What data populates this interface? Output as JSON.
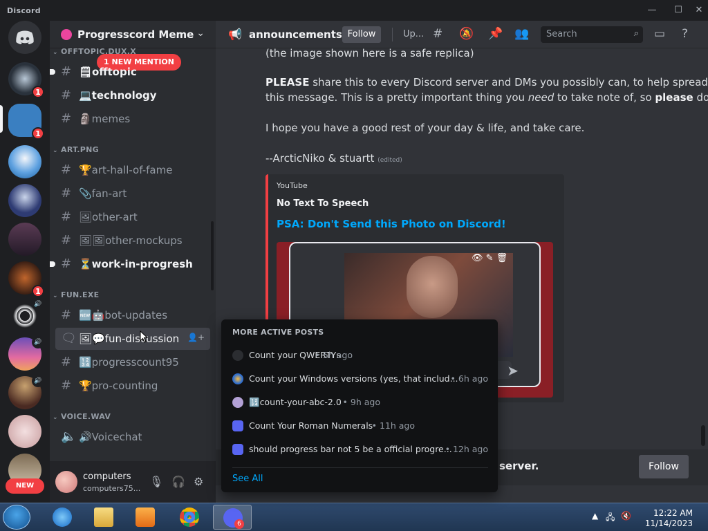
{
  "window": {
    "title": "Discord"
  },
  "server": {
    "name": "Progresscord Meme"
  },
  "rail": {
    "new_label": "NEW",
    "badge_1": "1",
    "badge_2": "1",
    "badge_3": "1"
  },
  "sidebar": {
    "mention_pill": "1 NEW MENTION",
    "categories": [
      {
        "name": "OFFTOPIC.DUX.X"
      },
      {
        "name": "ART.PNG"
      },
      {
        "name": "FUN.EXE"
      },
      {
        "name": "VOICE.WAV"
      }
    ],
    "channels": {
      "offtopic": "🗒offtopic",
      "technology": "💻technology",
      "memes": "🗿memes",
      "art_hall": "🏆art-hall-of-fame",
      "fan_art": "📎fan-art",
      "other_art": "🖼other-art",
      "other_mockups": "🖼🖼other-mockups",
      "wip": "⏳work-in-progresh",
      "bot_updates": "🆕🤖bot-updates",
      "fun_discussion": "🖼💬fun-discussion",
      "progresscount": "🔢progresscount95",
      "pro_counting": "🏆pro-counting",
      "voicechat": "🔊Voicechat"
    }
  },
  "user": {
    "name": "computers",
    "tag": "computers75..."
  },
  "chat": {
    "channel_name": "announcements",
    "follow_label": "Follow",
    "topic": "Up...",
    "search_placeholder": "Search",
    "line0": "(the image shown here is a safe replica)",
    "line1a_bold": "PLEASE",
    "line1a": " share this to every Discord server and DMs you possibly can, to help spread",
    "line1b_pre": "this message. This is a pretty important thing you ",
    "line1b_em": "need",
    "line1b_mid": " to take note of, so ",
    "line1b_bold": "please",
    "line1b_post": " do.",
    "line2": "I hope you have a good rest of your day & life, and take care.",
    "line3": "--ArcticNiko & stuartt",
    "edited": "(edited)",
    "embed": {
      "provider": "YouTube",
      "author": "No Text To Speech",
      "title": "PSA: Don't Send this Photo on Discord!"
    },
    "followbar_text": "server.",
    "followbar_btn": "Follow"
  },
  "popup": {
    "title": "MORE ACTIVE POSTS",
    "posts": [
      {
        "title": "Count your QWERTYs",
        "time": "5h ago"
      },
      {
        "title": "Count your Windows versions (yes, that includ...",
        "time": "6h ago"
      },
      {
        "title": "🔢count-your-abc-2.0",
        "time": "9h ago"
      },
      {
        "title": "Count Your Roman Numerals",
        "time": "11h ago"
      },
      {
        "title": "should progress bar not 5 be a official progre...",
        "time": "12h ago"
      }
    ],
    "see_all": "See All"
  },
  "taskbar": {
    "time": "12:22 AM",
    "date": "11/14/2023",
    "discord_badge": "6"
  },
  "colors": {
    "accent": "#5865f2",
    "danger": "#f23f43",
    "link": "#00a8fc"
  }
}
